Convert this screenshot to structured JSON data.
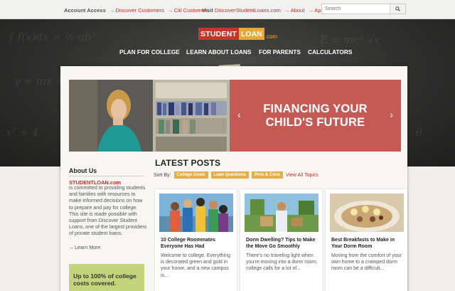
{
  "topbar": {
    "account_label": "Account Access",
    "account_links": [
      "Discover Customers",
      "Citi Customers"
    ],
    "visit_label": "Visit",
    "visit_links": [
      "DiscoverStudentLoans.com",
      "About",
      "Apply"
    ],
    "search_placeholder": "Search",
    "search_icon": "magnifier-icon"
  },
  "logo": {
    "part1": "STUDENT",
    "part2": "LOAN",
    "part3": ".com"
  },
  "nav": {
    "items": [
      "PLAN FOR COLLEGE",
      "LEARN ABOUT LOANS",
      "FOR PARENTS",
      "CALCULATORS"
    ],
    "color": "#ffffff"
  },
  "hero": {
    "title": "FINANCING YOUR CHILD'S FUTURE",
    "panel_color": "#c55a55",
    "prev_icon": "chevron-left-icon",
    "next_icon": "chevron-right-icon"
  },
  "sidebar": {
    "about_heading": "About Us",
    "brand": "STUDENTLOAN.com",
    "body": "is committed to providing students and families with resources to make informed decisions on how to prepare and pay for college. This site is made possible with support from Discover Student Loans, one of the largest providers of private student loans.",
    "learn_more": "Learn More",
    "promo": "Up to 100% of college costs covered.",
    "promo_color": "#c4d47a"
  },
  "posts": {
    "heading": "LATEST POSTS",
    "sort_by": "Sort By:",
    "filters": [
      "College Costs",
      "Loan Questions",
      "Pros & Cons"
    ],
    "view_all": "View All Topics",
    "chip_color": "#e4ad4a",
    "link_color": "#b8322a",
    "cards": [
      {
        "title": "10 College Roommates Everyone Has Had",
        "excerpt": "Welcome to college. Everything is decorated green and gold in your honor, and a new campus is..."
      },
      {
        "title": "Dorm Dwelling? Tips to Make the Move Go Smoothly",
        "excerpt": "There's no traveling light when you're moving into a dorm room; college calls for a lot of..."
      },
      {
        "title": "Best Breakfasts to Make in Your Dorm Room",
        "excerpt": "Moving from the comfort of your own home to a cramped dorm room can be a difficult..."
      }
    ]
  }
}
